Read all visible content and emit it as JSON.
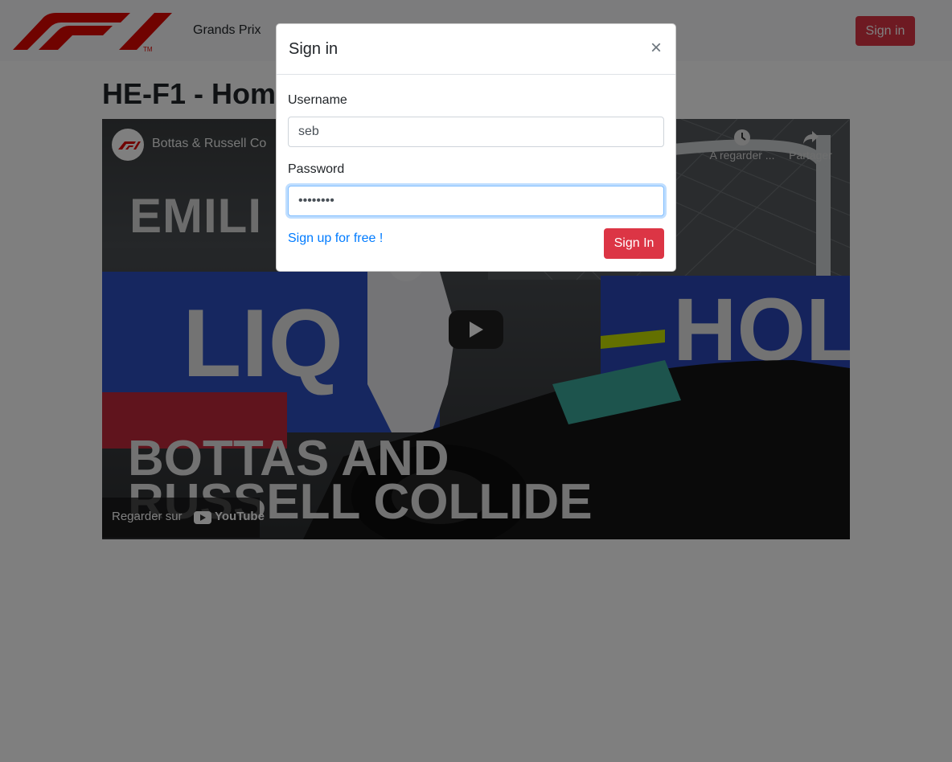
{
  "navbar": {
    "logo_mark": "F1",
    "logo_tm": "TM",
    "links": [
      {
        "label": "Grands Prix"
      }
    ],
    "signin_label": "Sign in"
  },
  "main": {
    "title": "HE-F1 - Hom"
  },
  "video": {
    "title": "Bottas & Russell Co",
    "watch_later_label": "A regarder ...",
    "share_label": "Partager",
    "overlay_text_1": "EMILI",
    "overlay_text_2": "BOTTAS AND",
    "overlay_text_3": "RUSSELL COLLIDE",
    "watch_on_label": "Regarder sur",
    "platform_label": "YouTube"
  },
  "modal": {
    "title": "Sign in",
    "close_symbol": "×",
    "username_label": "Username",
    "username_value": "seb",
    "password_label": "Password",
    "password_value": "••••••••",
    "signup_link": "Sign up for free !",
    "submit_label": "Sign In"
  },
  "colors": {
    "brand_red": "#dc3545",
    "logo_red": "#e10600",
    "link_blue": "#007bff",
    "focus_border": "#80bdff"
  },
  "icons": [
    "f1-logo-icon",
    "close-icon",
    "clock-icon",
    "share-icon",
    "play-icon",
    "youtube-icon"
  ]
}
